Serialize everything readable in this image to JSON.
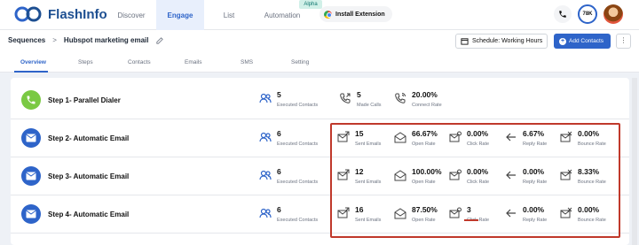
{
  "app": {
    "name": "FlashInfo"
  },
  "nav": [
    {
      "label": "Discover"
    },
    {
      "label": "Engage"
    },
    {
      "label": "List"
    },
    {
      "label": "Automation"
    }
  ],
  "alpha_badge": "Alpha",
  "install_extension": "Install Extension",
  "credits": "78K",
  "breadcrumb": {
    "root": "Sequences",
    "current": "Hubspot marketing email"
  },
  "schedule_label": "Schedule: Working Hours",
  "add_contacts_label": "Add Contacts",
  "more_label": "⋮",
  "tabs": [
    {
      "label": "Overview"
    },
    {
      "label": "Steps"
    },
    {
      "label": "Contacts"
    },
    {
      "label": "Emails"
    },
    {
      "label": "SMS"
    },
    {
      "label": "Setting"
    }
  ],
  "steps": [
    {
      "label": "Step 1- Parallel Dialer",
      "type": "dialer",
      "executed": {
        "value": "5",
        "label": "Executed Contacts"
      },
      "metrics": [
        {
          "value": "5",
          "label": "Made Calls"
        },
        {
          "value": "20.00%",
          "label": "Connect Rate"
        }
      ]
    },
    {
      "label": "Step 2- Automatic Email",
      "type": "email",
      "executed": {
        "value": "6",
        "label": "Executed Contacts"
      },
      "metrics": [
        {
          "value": "15",
          "label": "Sent Emails"
        },
        {
          "value": "66.67%",
          "label": "Open Rate"
        },
        {
          "value": "0.00%",
          "label": "Click Rate"
        },
        {
          "value": "6.67%",
          "label": "Reply Rate"
        },
        {
          "value": "0.00%",
          "label": "Bounce Rate"
        }
      ]
    },
    {
      "label": "Step 3- Automatic Email",
      "type": "email",
      "executed": {
        "value": "6",
        "label": "Executed Contacts"
      },
      "metrics": [
        {
          "value": "12",
          "label": "Sent Emails"
        },
        {
          "value": "100.00%",
          "label": "Open Rate"
        },
        {
          "value": "0.00%",
          "label": "Click Rate"
        },
        {
          "value": "0.00%",
          "label": "Reply Rate"
        },
        {
          "value": "8.33%",
          "label": "Bounce Rate"
        }
      ]
    },
    {
      "label": "Step 4- Automatic Email",
      "type": "email",
      "executed": {
        "value": "6",
        "label": "Executed Contacts"
      },
      "metrics": [
        {
          "value": "16",
          "label": "Sent Emails"
        },
        {
          "value": "87.50%",
          "label": "Open Rate"
        },
        {
          "value": "3",
          "label": "Click Rate"
        },
        {
          "value": "0.00%",
          "label": "Reply Rate"
        },
        {
          "value": "0.00%",
          "label": "Bounce Rate"
        }
      ]
    }
  ],
  "colors": {
    "primary": "#2e64c9",
    "green": "#7ac943",
    "highlight": "#c0392b"
  }
}
